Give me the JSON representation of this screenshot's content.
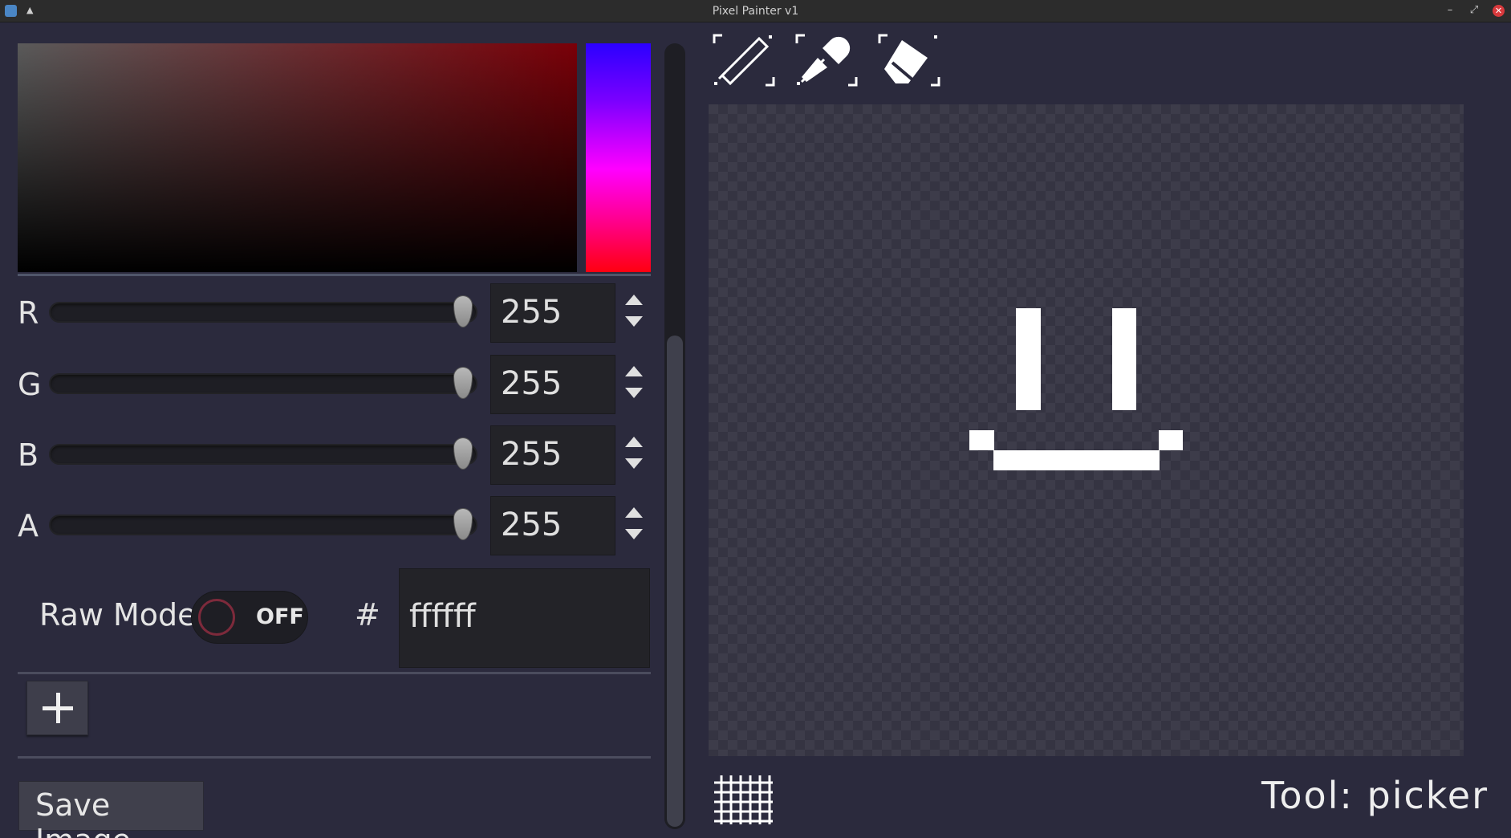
{
  "window": {
    "title": "Pixel Painter v1",
    "shade_glyph": "▲",
    "minimize_glyph": "–",
    "maximize_glyph": "⤢",
    "close_glyph": "✕"
  },
  "color_picker": {
    "hue_color": "#ff0010",
    "channels": [
      {
        "label": "R",
        "value": "255",
        "level": 1.0
      },
      {
        "label": "G",
        "value": "255",
        "level": 1.0
      },
      {
        "label": "B",
        "value": "255",
        "level": 1.0
      },
      {
        "label": "A",
        "value": "255",
        "level": 1.0
      }
    ],
    "raw_mode": {
      "label": "Raw Mode",
      "state": "OFF"
    },
    "hex": {
      "prefix": "#",
      "value": "ffffff"
    }
  },
  "swatches": {
    "add_icon": "plus-icon"
  },
  "save_button": {
    "label": "Save Image"
  },
  "tools": [
    {
      "name": "pencil",
      "icon": "pencil-icon"
    },
    {
      "name": "picker",
      "icon": "eyedropper-icon"
    },
    {
      "name": "eraser",
      "icon": "eraser-icon"
    }
  ],
  "canvas": {
    "pixel_color": "#ffffff",
    "background": "checkerboard"
  },
  "status": {
    "tool_text": "Tool: picker"
  },
  "grid_toggle": {
    "icon": "grid-icon"
  }
}
